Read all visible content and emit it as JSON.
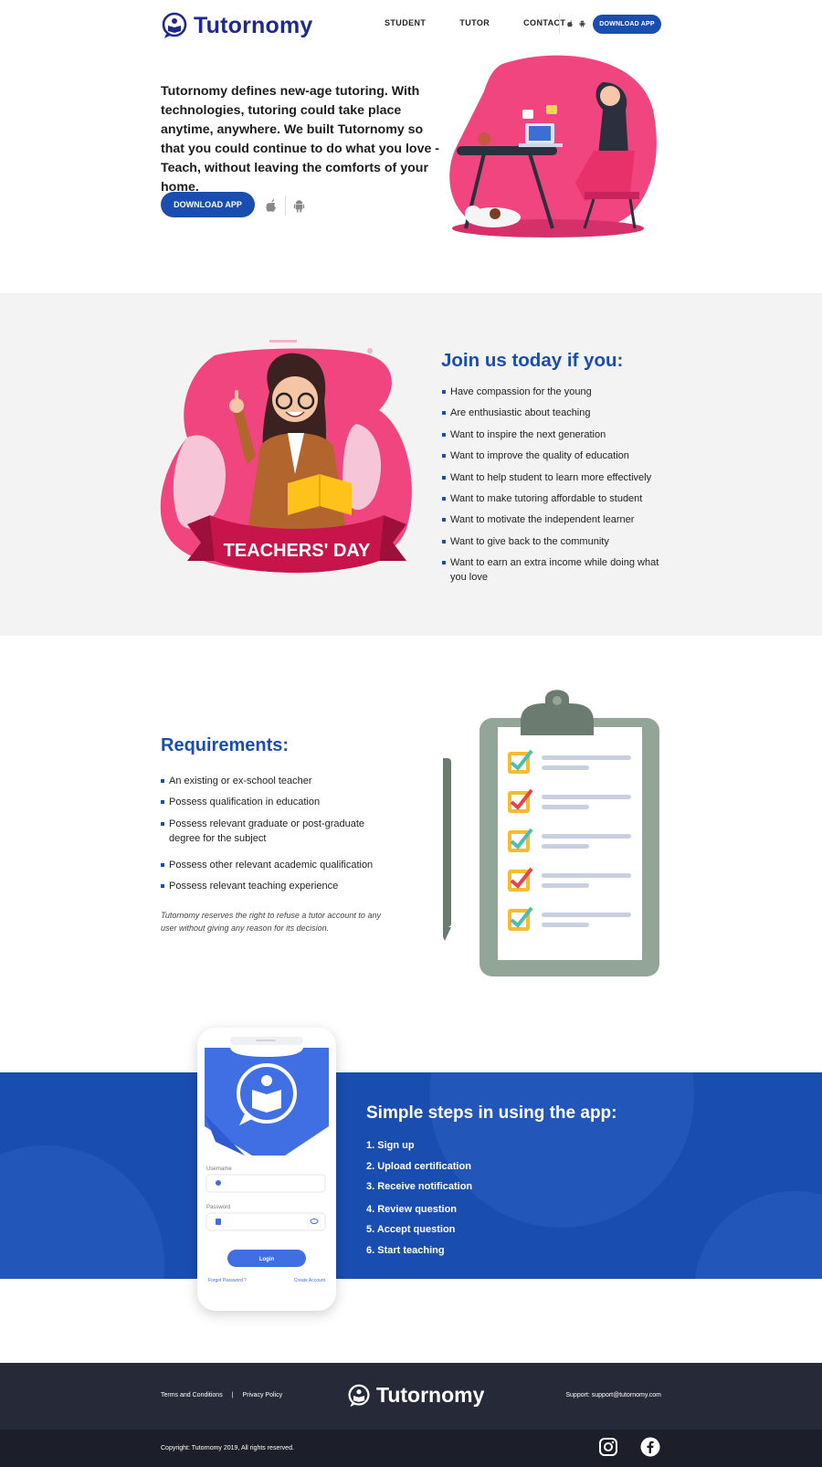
{
  "header": {
    "brand": "Tutornomy",
    "nav": [
      {
        "label": "STUDENT"
      },
      {
        "label": "TUTOR"
      },
      {
        "label": "CONTACT"
      }
    ],
    "download_label": "DOWNLOAD APP"
  },
  "hero": {
    "text": "Tutornomy defines new-age tutoring. With technologies, tutoring could take place anytime, anywhere. We built Tutornomy so that you could continue to do what you love - Teach, without leaving the comforts of your home.",
    "download_label": "DOWNLOAD APP"
  },
  "join": {
    "banner": "TEACHERS' DAY",
    "title": "Join us today if you:",
    "items": [
      "Have compassion for the young",
      "Are enthusiastic about teaching",
      "Want to inspire the next generation",
      "Want to improve the quality of education",
      "Want to help student to learn more effectively",
      "Want to make tutoring affordable to student",
      "Want to motivate the independent learner",
      "Want to give back to the community",
      "Want to earn an extra income while doing what you love"
    ]
  },
  "requirements": {
    "title": "Requirements:",
    "items": [
      "An existing or ex-school teacher",
      "Possess qualification in education",
      "Possess relevant graduate or post-graduate degree for the subject",
      "Possess other relevant academic qualification",
      "Possess relevant teaching experience"
    ],
    "note": "Tutornomy reserves the right to refuse a tutor account to any user without giving any reason for its decision."
  },
  "phone": {
    "username_label": "Username",
    "password_label": "Password",
    "login_label": "Login",
    "forgot_label": "Forget Password ?",
    "create_label": "Create Account"
  },
  "steps": {
    "title": "Simple steps in using the app:",
    "items": [
      "1. Sign up",
      "2. Upload certification",
      "3. Receive notification",
      "4. Review question",
      "5. Accept question",
      "6. Start teaching"
    ]
  },
  "footer": {
    "terms": "Terms and Conditions",
    "divider": "|",
    "privacy": "Privacy Policy",
    "brand": "Tutornomy",
    "support": "Support: support@tutornomy.com",
    "copyright": "Copyright: Tutornomy 2019, All rights reserved."
  },
  "colors": {
    "primary": "#1a4db0",
    "brand_dark": "#1d2a8c",
    "pink": "#f0457e",
    "footer": "#262938",
    "subfooter": "#1c1e2a"
  },
  "icons": [
    "apple-icon",
    "android-icon",
    "instagram-icon",
    "facebook-icon"
  ]
}
